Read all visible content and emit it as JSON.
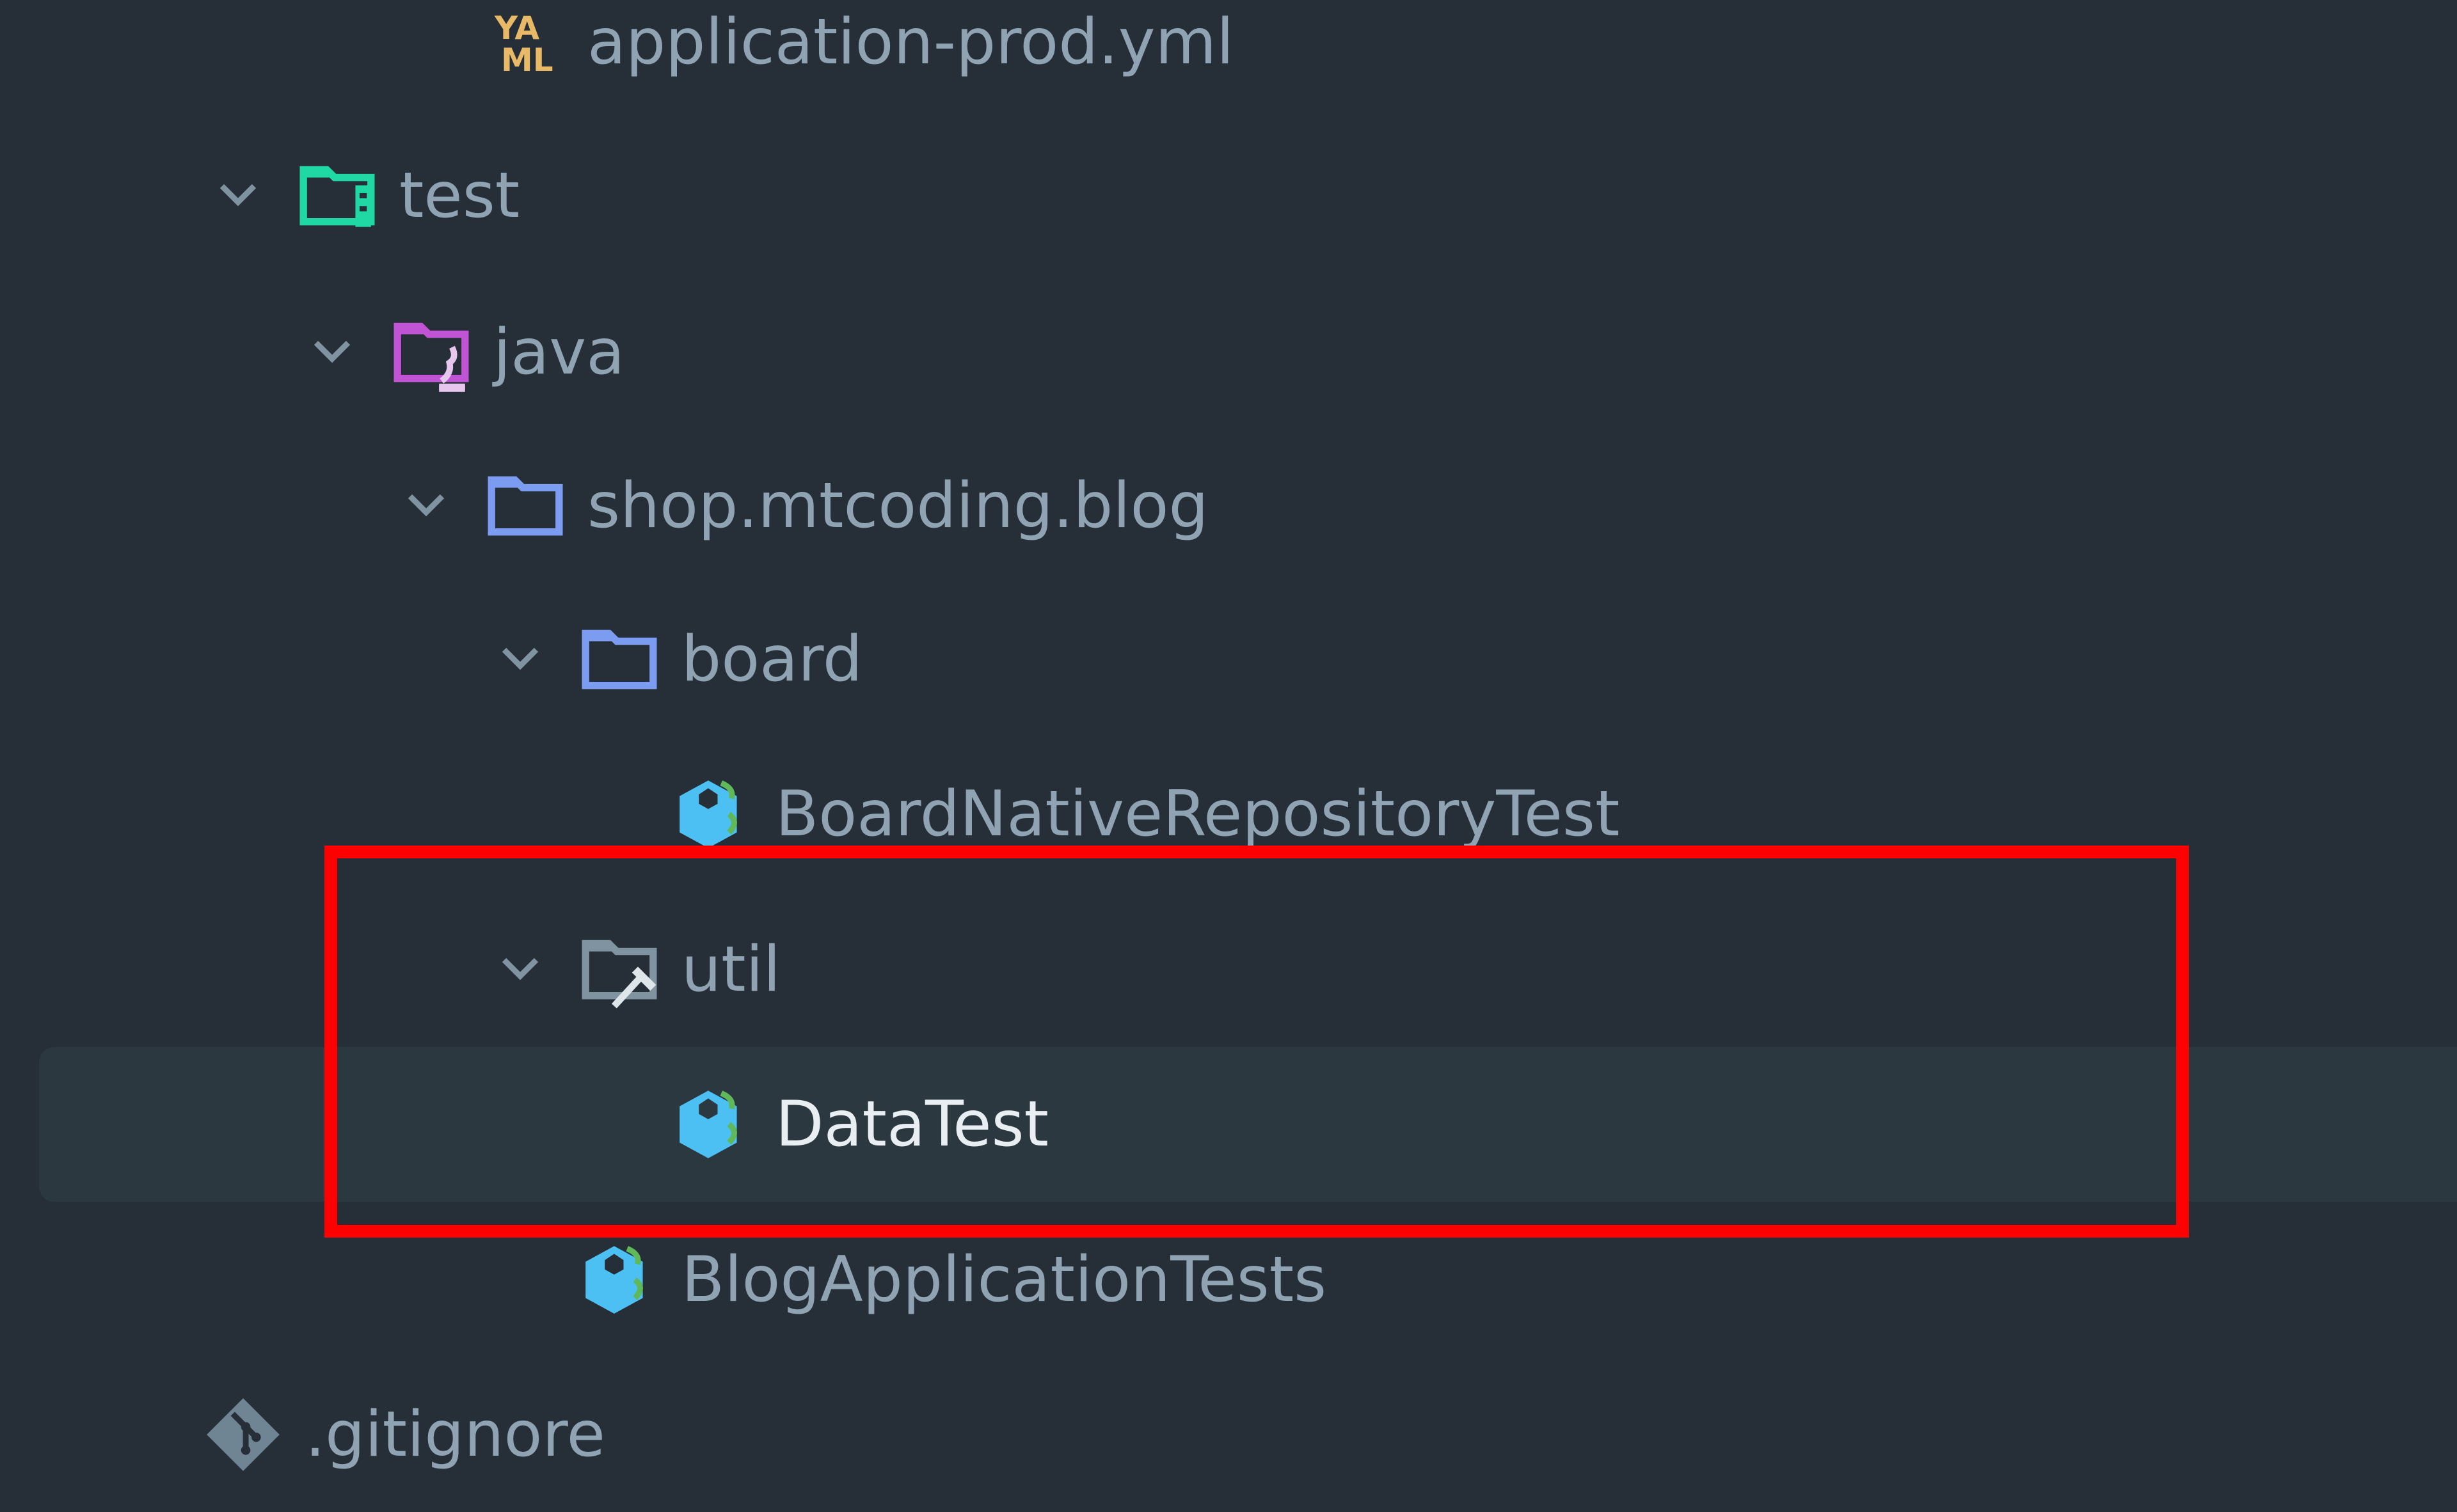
{
  "project_tree": {
    "items": [
      {
        "label": "application-prod.yml",
        "icon": "yaml-file-icon",
        "depth": 3,
        "expandable": false
      },
      {
        "label": "test",
        "icon": "test-root-folder-icon",
        "depth": 1,
        "expandable": true,
        "expanded": true
      },
      {
        "label": "java",
        "icon": "test-sources-folder-icon",
        "depth": 2,
        "expandable": true,
        "expanded": true
      },
      {
        "label": "shop.mtcoding.blog",
        "icon": "package-folder-icon",
        "depth": 3,
        "expandable": true,
        "expanded": true
      },
      {
        "label": "board",
        "icon": "package-folder-icon",
        "depth": 4,
        "expandable": true,
        "expanded": true
      },
      {
        "label": "BoardNativeRepositoryTest",
        "icon": "test-class-icon",
        "depth": 5,
        "expandable": false
      },
      {
        "label": "util",
        "icon": "util-package-folder-icon",
        "depth": 4,
        "expandable": true,
        "expanded": true
      },
      {
        "label": "DataTest",
        "icon": "test-class-icon",
        "depth": 5,
        "expandable": false,
        "selected": true
      },
      {
        "label": "BlogApplicationTests",
        "icon": "test-class-icon",
        "depth": 4,
        "expandable": false
      },
      {
        "label": ".gitignore",
        "icon": "git-file-icon",
        "depth": 0,
        "expandable": false
      }
    ]
  },
  "annotation": {
    "color": "#ff0000",
    "highlights": [
      "util",
      "DataTest"
    ]
  },
  "colors": {
    "background": "#262f38",
    "selected_row": "#2b3840",
    "text": "#8fa3b3",
    "selected_text": "#e9eef2",
    "test_folder": "#1fd8a4",
    "java_folder": "#c054d4",
    "package_folder": "#7b9cf0",
    "test_class": "#4cc0f2",
    "yaml": "#e8b967"
  }
}
